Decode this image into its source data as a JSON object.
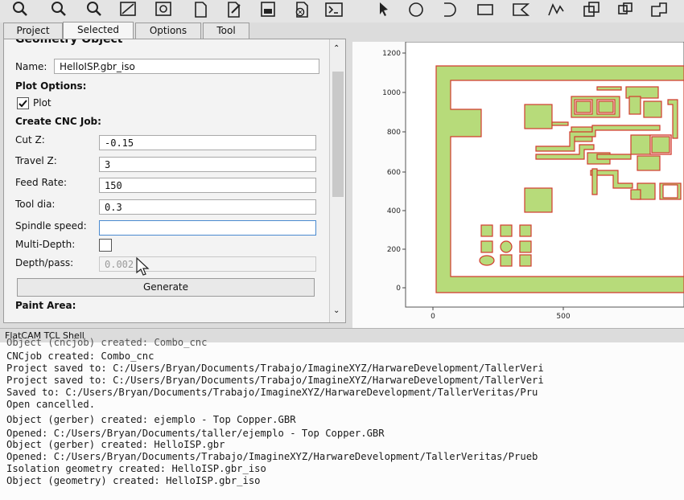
{
  "tabs": [
    "Project",
    "Selected",
    "Options",
    "Tool"
  ],
  "active_tab": "Selected",
  "panel": {
    "section_title": "Geometry Object",
    "name_label": "Name:",
    "name_value": "HelloISP.gbr_iso",
    "plot_options": "Plot Options:",
    "plot_checkbox": "Plot",
    "cnc_title": "Create CNC Job:",
    "fields": [
      {
        "label": "Cut Z:",
        "value": "-0.15"
      },
      {
        "label": "Travel Z:",
        "value": "3"
      },
      {
        "label": "Feed Rate:",
        "value": "150"
      },
      {
        "label": "Tool dia:",
        "value": "0.3"
      },
      {
        "label": "Spindle speed:",
        "value": ""
      }
    ],
    "multidepth_label": "Multi-Depth:",
    "depth_label": "Depth/pass:",
    "depth_value": "0.002",
    "generate": "Generate",
    "paint_title": "Paint Area:"
  },
  "plot": {
    "y_ticks": [
      "0",
      "200",
      "400",
      "600",
      "800",
      "1000",
      "1200"
    ],
    "x_ticks": [
      "0",
      "500"
    ]
  },
  "shell": {
    "title": "FlatCAM TCL Shell",
    "lines": [
      "Object (cncjob) created: Combo_cnc",
      "CNCjob created: Combo_cnc",
      "Project saved to: C:/Users/Bryan/Documents/Trabajo/ImagineXYZ/HarwareDevelopment/TallerVeri",
      "Project saved to: C:/Users/Bryan/Documents/Trabajo/ImagineXYZ/HarwareDevelopment/TallerVeri",
      "Saved to: C:/Users/Bryan/Documents/Trabajo/ImagineXYZ/HarwareDevelopment/TallerVeritas/Pru",
      "Open cancelled.",
      "Object (gerber) created: ejemplo - Top Copper.GBR",
      "Opened: C:/Users/Bryan/Documents/taller/ejemplo - Top Copper.GBR",
      "Object (gerber) created: HelloISP.gbr",
      "Opened: C:/Users/Bryan/Documents/Trabajo/ImagineXYZ/HarwareDevelopment/TallerVeritas/Prueb",
      "Isolation geometry created: HelloISP.gbr_iso",
      "Object (geometry) created: HelloISP.gbr_iso"
    ]
  }
}
